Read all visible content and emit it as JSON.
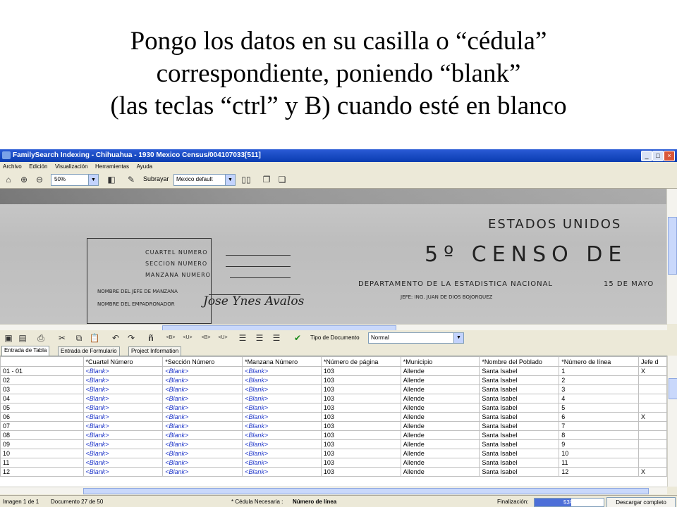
{
  "slide": {
    "title_lines": [
      "Pongo los datos en su casilla o “cédula”",
      "correspondiente, poniendo “blank”",
      "(las teclas “ctrl” y B) cuando esté en blanco"
    ]
  },
  "window": {
    "title": "FamilySearch Indexing - Chihuahua - 1930 Mexico Census/004107033[511]",
    "menu": [
      "Archivo",
      "Edición",
      "Visualización",
      "Herramientas",
      "Ayuda"
    ]
  },
  "toolbar": {
    "zoom": "50%",
    "subrayar_label": "Subrayar",
    "subrayar_value": "Mexico default"
  },
  "image_text": {
    "country": "ESTADOS UNIDOS",
    "censo": "5º  CENSO  DE",
    "dept": "DEPARTAMENTO DE LA ESTADISTICA NACIONAL",
    "jefe": "JEFE: ING. JUAN DE DIOS BOJORQUEZ",
    "fecha": "15 DE MAYO",
    "cuartel": "CUARTEL NUMERO",
    "seccion": "SECCION NUMERO",
    "manzana": "MANZANA NUMERO",
    "jefe_manzana": "NOMBRE DEL JEFE DE MANZANA",
    "empadronador": "NOMBRE DEL EMPADRONADOR",
    "signature": "Jose Ynes Avalos"
  },
  "toolbar2": {
    "tipo_label": "Tipo de Documento",
    "tipo_value": "Normal"
  },
  "tabs": [
    "Entrada de Tabla",
    "Entrada de Formulario",
    "Project Information"
  ],
  "grid": {
    "columns": [
      "",
      "*Cuartel Número",
      "*Sección Número",
      "*Manzana Número",
      "*Número de página",
      "*Municipio",
      "*Nombre del Poblado",
      "*Número de línea",
      "Jefe d"
    ],
    "rows": [
      [
        "01 - 01",
        "<Blank>",
        "<Blank>",
        "<Blank>",
        "103",
        "Allende",
        "Santa Isabel",
        "1",
        "X"
      ],
      [
        "02",
        "<Blank>",
        "<Blank>",
        "<Blank>",
        "103",
        "Allende",
        "Santa Isabel",
        "2",
        ""
      ],
      [
        "03",
        "<Blank>",
        "<Blank>",
        "<Blank>",
        "103",
        "Allende",
        "Santa Isabel",
        "3",
        ""
      ],
      [
        "04",
        "<Blank>",
        "<Blank>",
        "<Blank>",
        "103",
        "Allende",
        "Santa Isabel",
        "4",
        ""
      ],
      [
        "05",
        "<Blank>",
        "<Blank>",
        "<Blank>",
        "103",
        "Allende",
        "Santa Isabel",
        "5",
        ""
      ],
      [
        "06",
        "<Blank>",
        "<Blank>",
        "<Blank>",
        "103",
        "Allende",
        "Santa Isabel",
        "6",
        "X"
      ],
      [
        "07",
        "<Blank>",
        "<Blank>",
        "<Blank>",
        "103",
        "Allende",
        "Santa Isabel",
        "7",
        ""
      ],
      [
        "08",
        "<Blank>",
        "<Blank>",
        "<Blank>",
        "103",
        "Allende",
        "Santa Isabel",
        "8",
        ""
      ],
      [
        "09",
        "<Blank>",
        "<Blank>",
        "<Blank>",
        "103",
        "Allende",
        "Santa Isabel",
        "9",
        ""
      ],
      [
        "10",
        "<Blank>",
        "<Blank>",
        "<Blank>",
        "103",
        "Allende",
        "Santa Isabel",
        "10",
        ""
      ],
      [
        "11",
        "<Blank>",
        "<Blank>",
        "<Blank>",
        "103",
        "Allende",
        "Santa Isabel",
        "11",
        ""
      ],
      [
        "12",
        "<Blank>",
        "<Blank>",
        "<Blank>",
        "103",
        "Allende",
        "Santa Isabel",
        "12",
        "X"
      ]
    ]
  },
  "status": {
    "imagen": "Imagen 1 de 1",
    "documento": "Documento 27 de 50",
    "cedula_label": "* Cédula Necesaria :",
    "cedula_value": "Número de línea",
    "finalizacion_label": "Finalización:",
    "progress": 53,
    "progress_text": "53%",
    "download": "Descargar completo"
  },
  "colors": {
    "titlebar": "#0a3cb0",
    "blank_text": "#1f36c8",
    "progress_fill": "#4d6fd8"
  }
}
